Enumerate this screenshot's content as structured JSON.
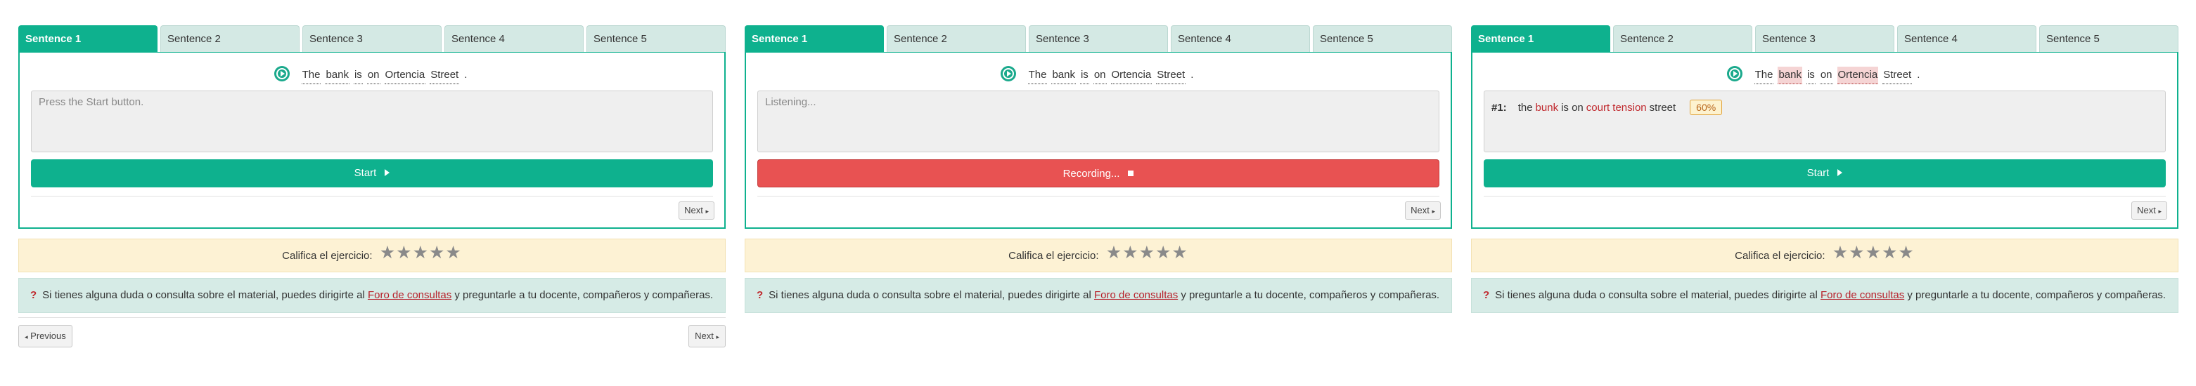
{
  "panels": [
    {
      "tabs": [
        "Sentence 1",
        "Sentence 2",
        "Sentence 3",
        "Sentence 4",
        "Sentence 5"
      ],
      "active_tab": 0,
      "sentence": [
        "The",
        "bank",
        "is",
        "on",
        "Ortencia",
        "Street",
        "."
      ],
      "transcript_placeholder": "Press the Start button.",
      "action_label": "Start",
      "action_state": "start",
      "next_label": "Next",
      "rating_label": "Califica el ejercicio:",
      "stars": 5,
      "help": {
        "before": "Si tienes alguna duda o consulta sobre el material, puedes dirigirte al",
        "link": "Foro de consultas",
        "after": "y preguntarle a tu docente, compañeros y compañeras."
      },
      "prev_label": "Previous",
      "next_outer_label": "Next"
    },
    {
      "tabs": [
        "Sentence 1",
        "Sentence 2",
        "Sentence 3",
        "Sentence 4",
        "Sentence 5"
      ],
      "active_tab": 0,
      "sentence": [
        "The",
        "bank",
        "is",
        "on",
        "Ortencia",
        "Street",
        "."
      ],
      "transcript_placeholder": "Listening...",
      "action_label": "Recording...",
      "action_state": "recording",
      "next_label": "Next",
      "rating_label": "Califica el ejercicio:",
      "stars": 5,
      "help": {
        "before": "Si tienes alguna duda o consulta sobre el material, puedes dirigirte al",
        "link": "Foro de consultas",
        "after": "y preguntarle a tu docente, compañeros y compañeras."
      }
    },
    {
      "tabs": [
        "Sentence 1",
        "Sentence 2",
        "Sentence 3",
        "Sentence 4",
        "Sentence 5"
      ],
      "active_tab": 0,
      "sentence": [
        "The",
        "bank",
        "is",
        "on",
        "Ortencia",
        "Street",
        "."
      ],
      "wrong_words": [
        1,
        4
      ],
      "result": {
        "number": "#1:",
        "words": [
          {
            "text": "the",
            "ok": true
          },
          {
            "text": "bunk",
            "ok": false
          },
          {
            "text": "is on",
            "ok": true
          },
          {
            "text": "court tension",
            "ok": false
          },
          {
            "text": "street",
            "ok": true
          }
        ],
        "score": "60%"
      },
      "action_label": "Start",
      "action_state": "start",
      "next_label": "Next",
      "rating_label": "Califica el ejercicio:",
      "stars": 5,
      "help": {
        "before": "Si tienes alguna duda o consulta sobre el material, puedes dirigirte al",
        "link": "Foro de consultas",
        "after": "y preguntarle a tu docente, compañeros y compañeras."
      }
    }
  ],
  "colors": {
    "accent": "#0eb18e",
    "tab_bg": "#d4e9e4",
    "recording": "#e85252",
    "rating_bg": "#fdf2d4",
    "help_bg": "#d6ebe6",
    "error_text": "#c0282d"
  },
  "icons": {
    "play": "play-circle-icon",
    "start": "triangle-play-icon",
    "recording": "stop-square-icon",
    "star": "star-icon",
    "help": "question-mark-icon",
    "caret": "caret-icon"
  }
}
